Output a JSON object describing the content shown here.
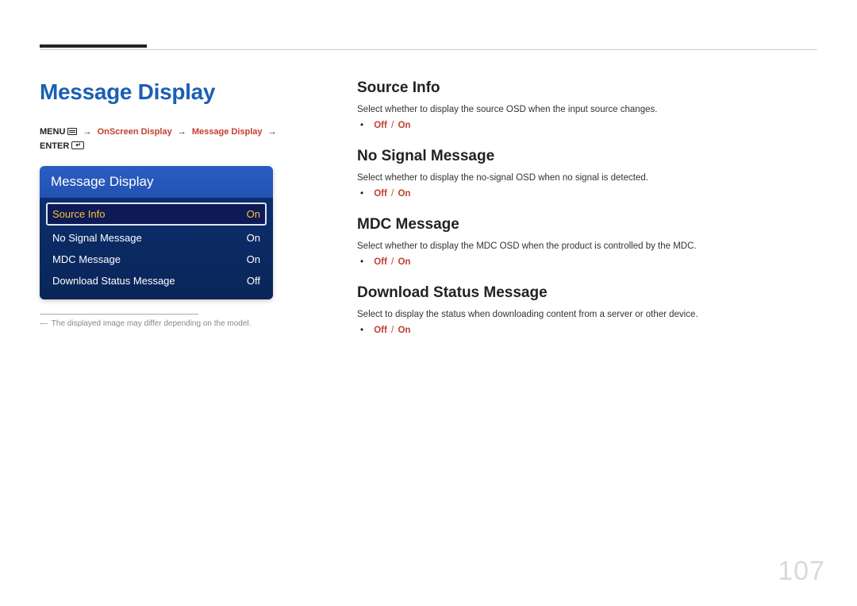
{
  "page_title": "Message Display",
  "breadcrumb": {
    "menu_label": "MENU",
    "path1": "OnScreen Display",
    "path2": "Message Display",
    "enter_label": "ENTER"
  },
  "osd": {
    "header": "Message Display",
    "rows": [
      {
        "label": "Source Info",
        "value": "On",
        "selected": true
      },
      {
        "label": "No Signal Message",
        "value": "On",
        "selected": false
      },
      {
        "label": "MDC Message",
        "value": "On",
        "selected": false
      },
      {
        "label": "Download Status Message",
        "value": "Off",
        "selected": false
      }
    ]
  },
  "footnote": "The displayed image may differ depending on the model.",
  "sections": [
    {
      "title": "Source Info",
      "desc": "Select whether to display the source OSD when the input source changes.",
      "opt1": "Off",
      "opt2": "On"
    },
    {
      "title": "No Signal Message",
      "desc": "Select whether to display the no-signal OSD when no signal is detected.",
      "opt1": "Off",
      "opt2": "On"
    },
    {
      "title": "MDC Message",
      "desc": "Select whether to display the MDC OSD when the product is controlled by the MDC.",
      "opt1": "Off",
      "opt2": "On"
    },
    {
      "title": "Download Status Message",
      "desc": "Select to display the status when downloading content from a server or other device.",
      "opt1": "Off",
      "opt2": "On"
    }
  ],
  "page_number": "107"
}
